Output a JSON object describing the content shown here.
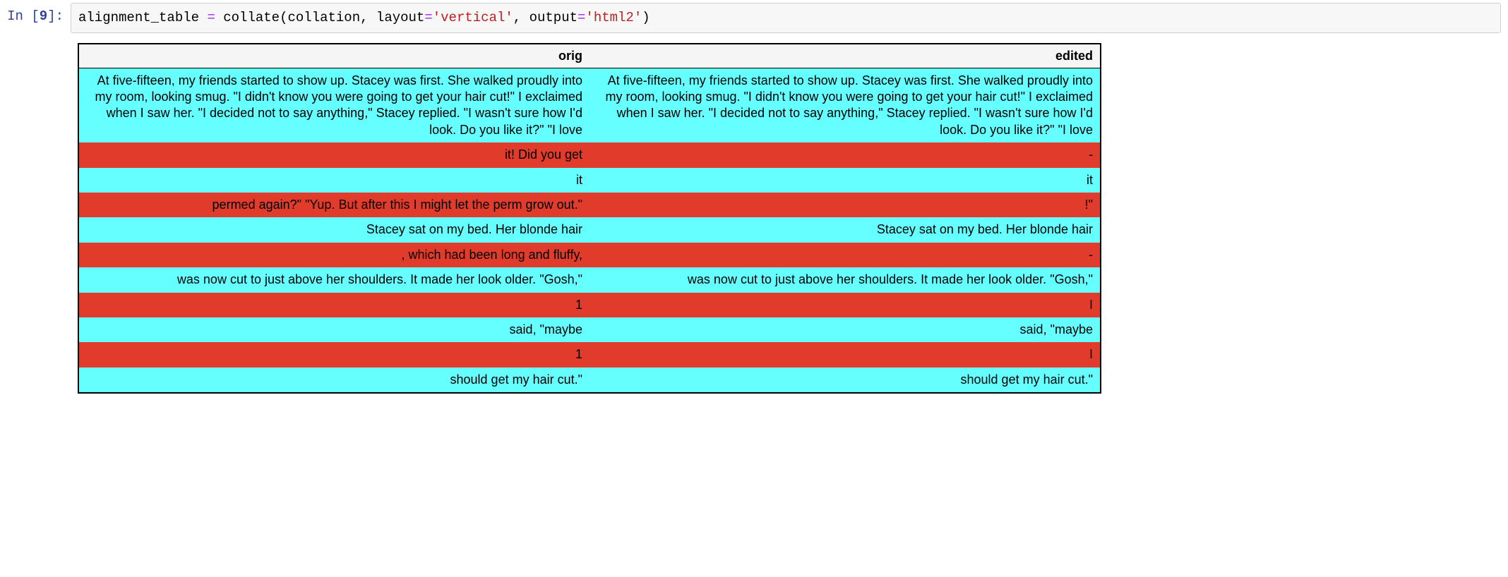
{
  "prompt": {
    "label": "In",
    "number": "9"
  },
  "code": {
    "assign_target": "alignment_table",
    "func": "collate",
    "arg0": "collation",
    "kw1_name": "layout",
    "kw1_value": "'vertical'",
    "kw2_name": "output",
    "kw2_value": "'html2'"
  },
  "table": {
    "headers": [
      "orig",
      "edited"
    ],
    "rows": [
      {
        "type": "invariant",
        "cells": [
          "At five-fifteen, my friends started to show up. Stacey was first. She walked proudly into my room, looking smug. \"I didn't know you were going to get your hair cut!\" I exclaimed when I saw her. \"I decided not to say anything,\" Stacey replied. \"I wasn't sure how I'd look. Do you like it?\" \"I love",
          "At five-fifteen, my friends started to show up. Stacey was first. She walked proudly into my room, looking smug. \"I didn't know you were going to get your hair cut!\" I exclaimed when I saw her. \"I decided not to say anything,\" Stacey replied. \"I wasn't sure how I'd look. Do you like it?\" \"I love"
        ]
      },
      {
        "type": "variant",
        "cells": [
          "it! Did you get",
          "-"
        ]
      },
      {
        "type": "invariant",
        "cells": [
          "it",
          "it"
        ]
      },
      {
        "type": "variant",
        "cells": [
          "permed again?\" \"Yup. But after this I might let the perm grow out.\"",
          "!\""
        ]
      },
      {
        "type": "invariant",
        "cells": [
          "Stacey sat on my bed. Her blonde hair",
          "Stacey sat on my bed. Her blonde hair"
        ]
      },
      {
        "type": "variant",
        "cells": [
          ", which had been long and fluffy,",
          "-"
        ]
      },
      {
        "type": "invariant",
        "cells": [
          "was now cut to just above her shoulders. It made her look older. \"Gosh,\"",
          "was now cut to just above her shoulders. It made her look older. \"Gosh,\""
        ]
      },
      {
        "type": "variant",
        "cells": [
          "1",
          "I"
        ]
      },
      {
        "type": "invariant",
        "cells": [
          "said, \"maybe",
          "said, \"maybe"
        ]
      },
      {
        "type": "variant",
        "cells": [
          "1",
          "I"
        ]
      },
      {
        "type": "invariant",
        "cells": [
          "should get my hair cut.\"",
          "should get my hair cut.\""
        ]
      }
    ]
  }
}
